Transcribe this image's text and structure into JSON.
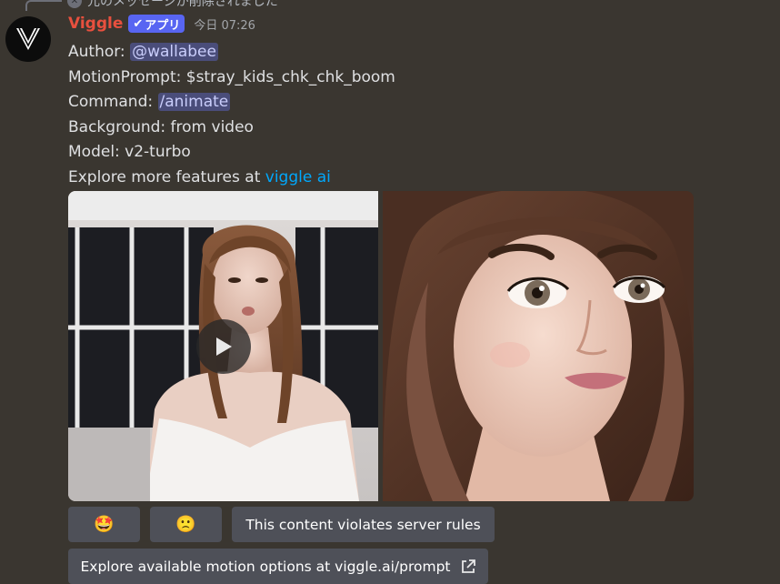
{
  "reply": {
    "text": "元のメッセージが削除されました"
  },
  "message": {
    "username": "Viggle",
    "badge": "アプリ",
    "timestamp": "今日 07:26",
    "author_label": "Author: ",
    "author_mention": "@wallabee",
    "motion_prompt": "MotionPrompt: $stray_kids_chk_chk_boom",
    "command_label": "Command: ",
    "command_mention": "/animate",
    "background": "Background: from video",
    "model": "Model: v2-turbo",
    "explore_label": "Explore more features at ",
    "explore_link": "viggle ai"
  },
  "buttons": {
    "reaction_1": "🤩",
    "reaction_2": "🙁",
    "violation": "This content violates server rules",
    "explore_motion": "Explore available motion options at viggle.ai/prompt"
  },
  "colors": {
    "background": "#3a3630",
    "username": "#e8503e",
    "badge": "#5865f2",
    "link": "#00a8fc",
    "button": "#4e5058"
  }
}
